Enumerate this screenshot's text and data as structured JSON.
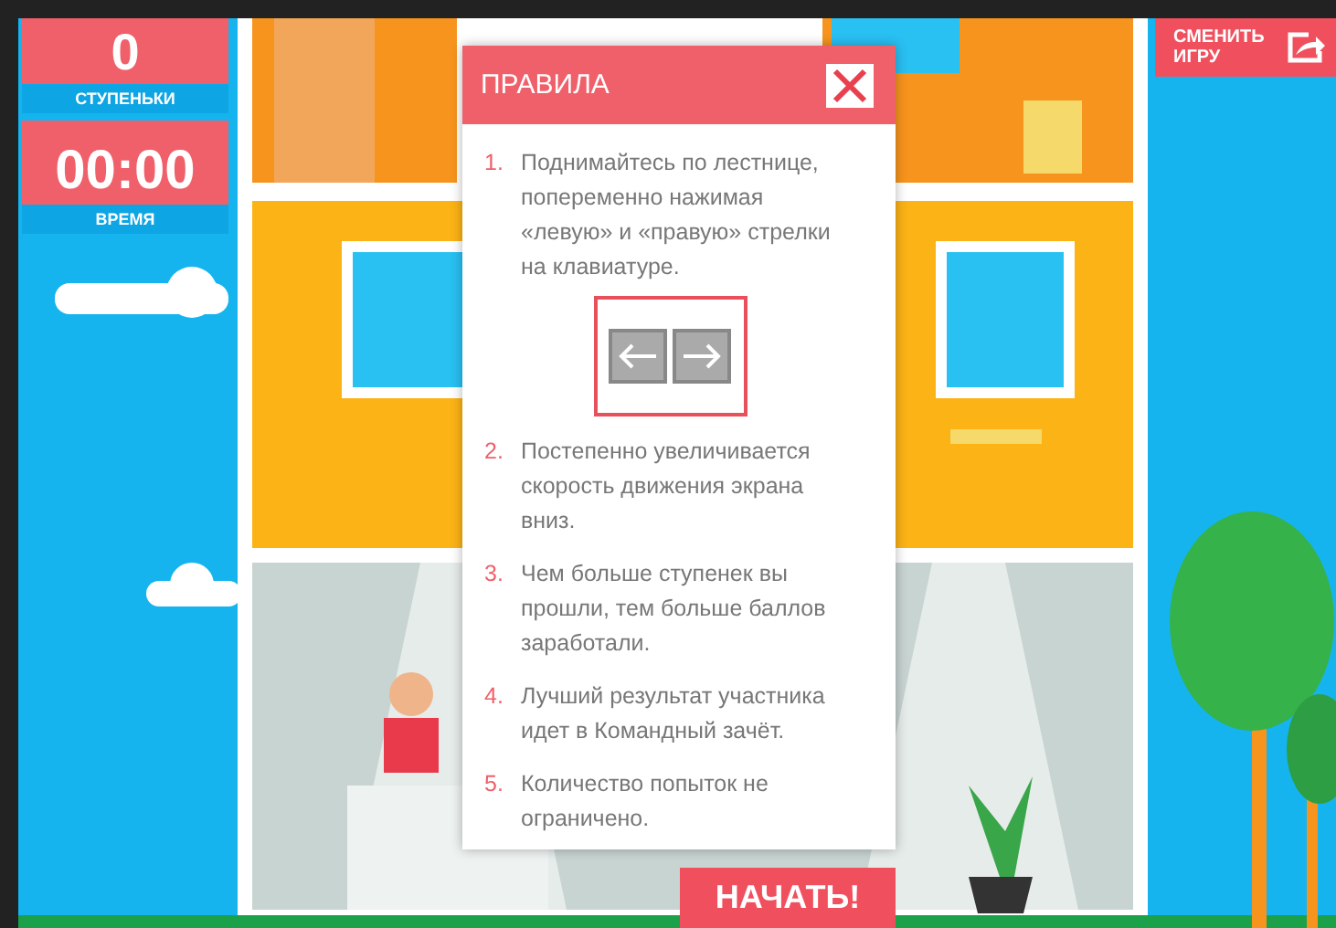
{
  "stats": [
    {
      "value": "0",
      "label": "СТУПЕНЬКИ"
    },
    {
      "value": "00:00",
      "label": "ВРЕМЯ"
    }
  ],
  "change_game_button": {
    "label": "СМЕНИТЬ ИГРУ"
  },
  "rules_dialog": {
    "title": "ПРАВИЛА",
    "items": [
      {
        "number": "1.",
        "text": "Поднимайтесь по лестнице, попеременно нажимая «левую» и «правую» стрелки на клавиатуре.",
        "kind": "keys"
      },
      {
        "number": "2.",
        "text": "Постепенно увеличивается скорость движения экрана вниз.",
        "kind": "text"
      },
      {
        "number": "3.",
        "text": "Чем больше ступенек вы прошли, тем больше баллов заработали.",
        "kind": "text"
      },
      {
        "number": "4.",
        "text": "Лучший результат участника идет в Командный зачёт.",
        "kind": "text"
      },
      {
        "number": "5.",
        "text": "Количество попыток не ограничено.",
        "kind": "text"
      }
    ]
  },
  "start_button": {
    "label": "НАЧАТЬ!"
  }
}
